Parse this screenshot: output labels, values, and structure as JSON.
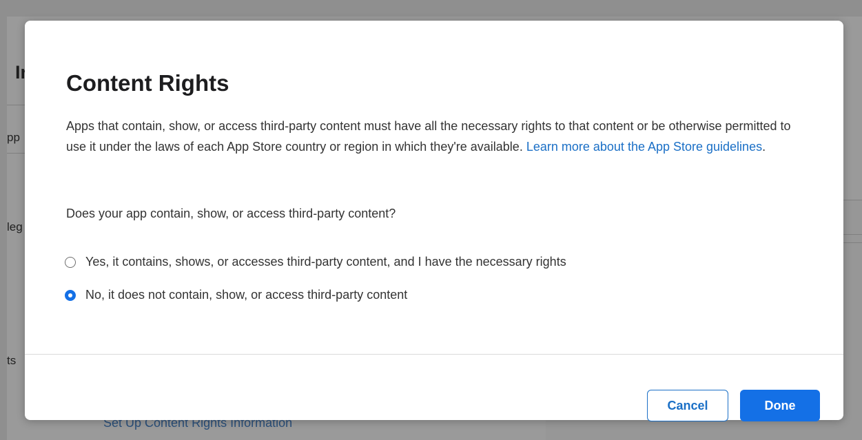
{
  "background": {
    "heading_fragment": "Ir",
    "row_fragments": [
      "pp",
      "leg",
      "ts"
    ],
    "link_text": "Set Up Content Rights Information"
  },
  "modal": {
    "title": "Content Rights",
    "description": "Apps that contain, show, or access third-party content must have all the necessary rights to that content or be otherwise permitted to use it under the laws of each App Store country or region in which they're available.",
    "link_text": "Learn more about the App Store guidelines",
    "link_suffix": ".",
    "question": "Does your app contain, show, or access third-party content?",
    "options": [
      {
        "label": "Yes, it contains, shows, or accesses third-party content, and I have the necessary rights",
        "selected": false
      },
      {
        "label": "No, it does not contain, show, or access third-party content",
        "selected": true
      }
    ],
    "buttons": {
      "cancel": "Cancel",
      "done": "Done"
    }
  },
  "colors": {
    "accent": "#1470e6",
    "link": "#1a6fc6",
    "overlay": "#8f8f8f"
  }
}
